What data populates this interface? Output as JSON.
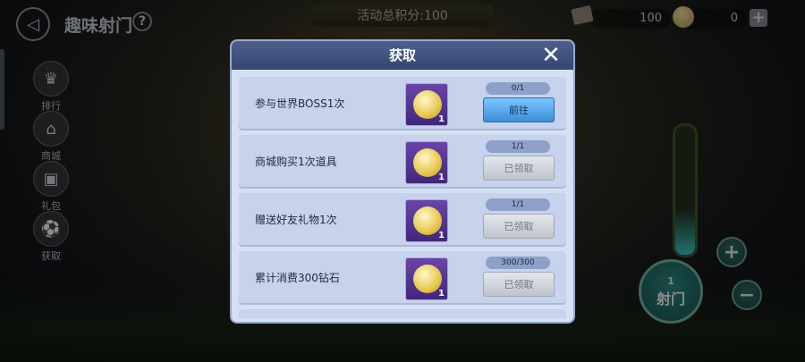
{
  "header": {
    "page_title": "趣味射门",
    "help_label": "?",
    "activity_points": "活动总积分:100",
    "resource_1_value": "100",
    "resource_2_value": "0",
    "plus_label": "+"
  },
  "sidebar": {
    "items": [
      {
        "label": "排行",
        "icon": "trophy-icon"
      },
      {
        "label": "商城",
        "icon": "shop-icon"
      },
      {
        "label": "礼包",
        "icon": "gift-icon"
      },
      {
        "label": "获取",
        "icon": "football-icon"
      }
    ]
  },
  "controls": {
    "shoot_count": "1",
    "shoot_label": "射门",
    "increase_label": "+",
    "decrease_label": "−"
  },
  "modal": {
    "title": "获取",
    "close_label": "✕",
    "tasks": [
      {
        "label": "参与世界BOSS1次",
        "progress": "0/1",
        "button": "前往",
        "reward_qty": "1",
        "state": "go"
      },
      {
        "label": "商城购买1次道具",
        "progress": "1/1",
        "button": "已领取",
        "reward_qty": "1",
        "state": "claimed"
      },
      {
        "label": "赠送好友礼物1次",
        "progress": "1/1",
        "button": "已领取",
        "reward_qty": "1",
        "state": "claimed"
      },
      {
        "label": "累计消费300钻石",
        "progress": "300/300",
        "button": "已领取",
        "reward_qty": "1",
        "state": "claimed"
      }
    ]
  },
  "colors": {
    "modal_header": "#3f5080",
    "go_button": "#5aaaf0",
    "claimed_button": "#cfd3da",
    "reward_bg": "#5a3a98"
  }
}
